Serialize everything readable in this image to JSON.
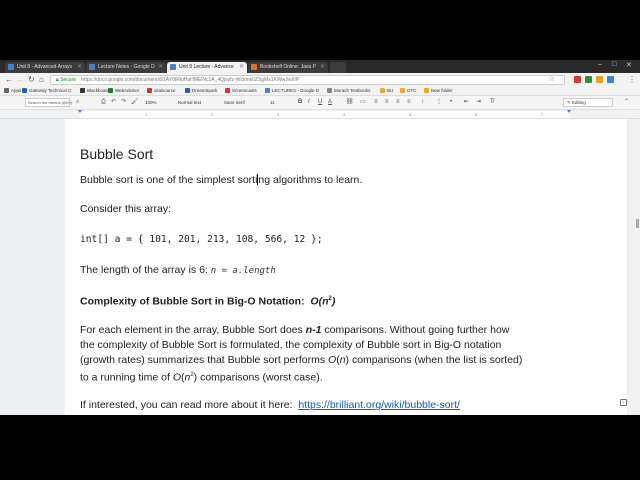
{
  "tabs": [
    {
      "label": "Unit 8 - Advanced Arrays",
      "color": "#4a7cd6"
    },
    {
      "label": "Lecture Notes - Google D",
      "color": "#4a7cd6"
    },
    {
      "label": "Unit 9 Lecture - Advance",
      "color": "#4a7cd6"
    },
    {
      "label": "Bookshelf Online: Java P",
      "color": "#e8721c"
    }
  ],
  "address": {
    "secure_label": "Secure",
    "url": "https://docs.google.com/document/d/1AY0tRluHaHMEiNc1A_4Qjsyfz-Wciorw0ZSgMs1KWwJvd/IP"
  },
  "bookmarks": [
    {
      "label": "Apps",
      "color": "#666"
    },
    {
      "label": "Gateway Technical C",
      "color": "#2a5db0"
    },
    {
      "label": "Blackboard",
      "color": "#333"
    },
    {
      "label": "WebAdvisor",
      "color": "#2a7a2a"
    },
    {
      "label": "vitalsource",
      "color": "#c33"
    },
    {
      "label": "DreamSpark",
      "color": "#2a5db0"
    },
    {
      "label": "Screencasts",
      "color": "#c33"
    },
    {
      "label": "LECTURES - Google D",
      "color": "#4a7cd6"
    },
    {
      "label": "Murach Textbooks",
      "color": "#888"
    },
    {
      "label": "BU",
      "color": "#e0b030"
    },
    {
      "label": "GTC",
      "color": "#e0b030"
    },
    {
      "label": "New folder",
      "color": "#e0b030"
    }
  ],
  "toolbar": {
    "search_placeholder": "Search the menus (Alt+/)",
    "style": "Normal text",
    "font": "Sans Serif",
    "size": "11",
    "zoom": "100%",
    "mode": "Editing"
  },
  "ruler_ticks": [
    "1",
    "2",
    "3",
    "4",
    "5",
    "6",
    "7"
  ],
  "document": {
    "heading": "Bubble Sort",
    "p1_before_cursor": "Bubble sort is one of the simplest sorti",
    "p1_after_cursor": "ng algorithms to learn.",
    "p2": "Consider this array:",
    "code": "int[] a = { 101, 201, 213, 108, 566, 12 };",
    "p3_text": "The length of the array is 6:",
    "p3_math": "n = a.length",
    "p4_text": "Complexity of Bubble Sort in Big-O Notation:",
    "p4_math_open": "O(n",
    "p4_math_sup": "2",
    "p4_math_close": ")",
    "p5_l1_a": "For each element in the array, Bubble Sort does ",
    "p5_l1_b": "n-1",
    "p5_l1_c": " comparisons.  Without going further how",
    "p5_l2": "the complexity of Bubble Sort is formulated, the complexity of Bubble sort in Big-O notation",
    "p5_l3_a": "(growth rates) summarizes that Bubble sort performs ",
    "p5_l3_b": "O",
    "p5_l3_c": "(",
    "p5_l3_d": "n",
    "p5_l3_e": ") comparisons (when the list is sorted)",
    "p5_l4_a": "to a running time of ",
    "p5_l4_b": "O",
    "p5_l4_c": "(",
    "p5_l4_d": "n",
    "p5_l4_sup": "2",
    "p5_l4_e": ") comparisons (worst case).",
    "p6_text": "If interested, you can read more about it here:",
    "p6_link": "https://brilliant.org/wiki/bubble-sort/"
  }
}
